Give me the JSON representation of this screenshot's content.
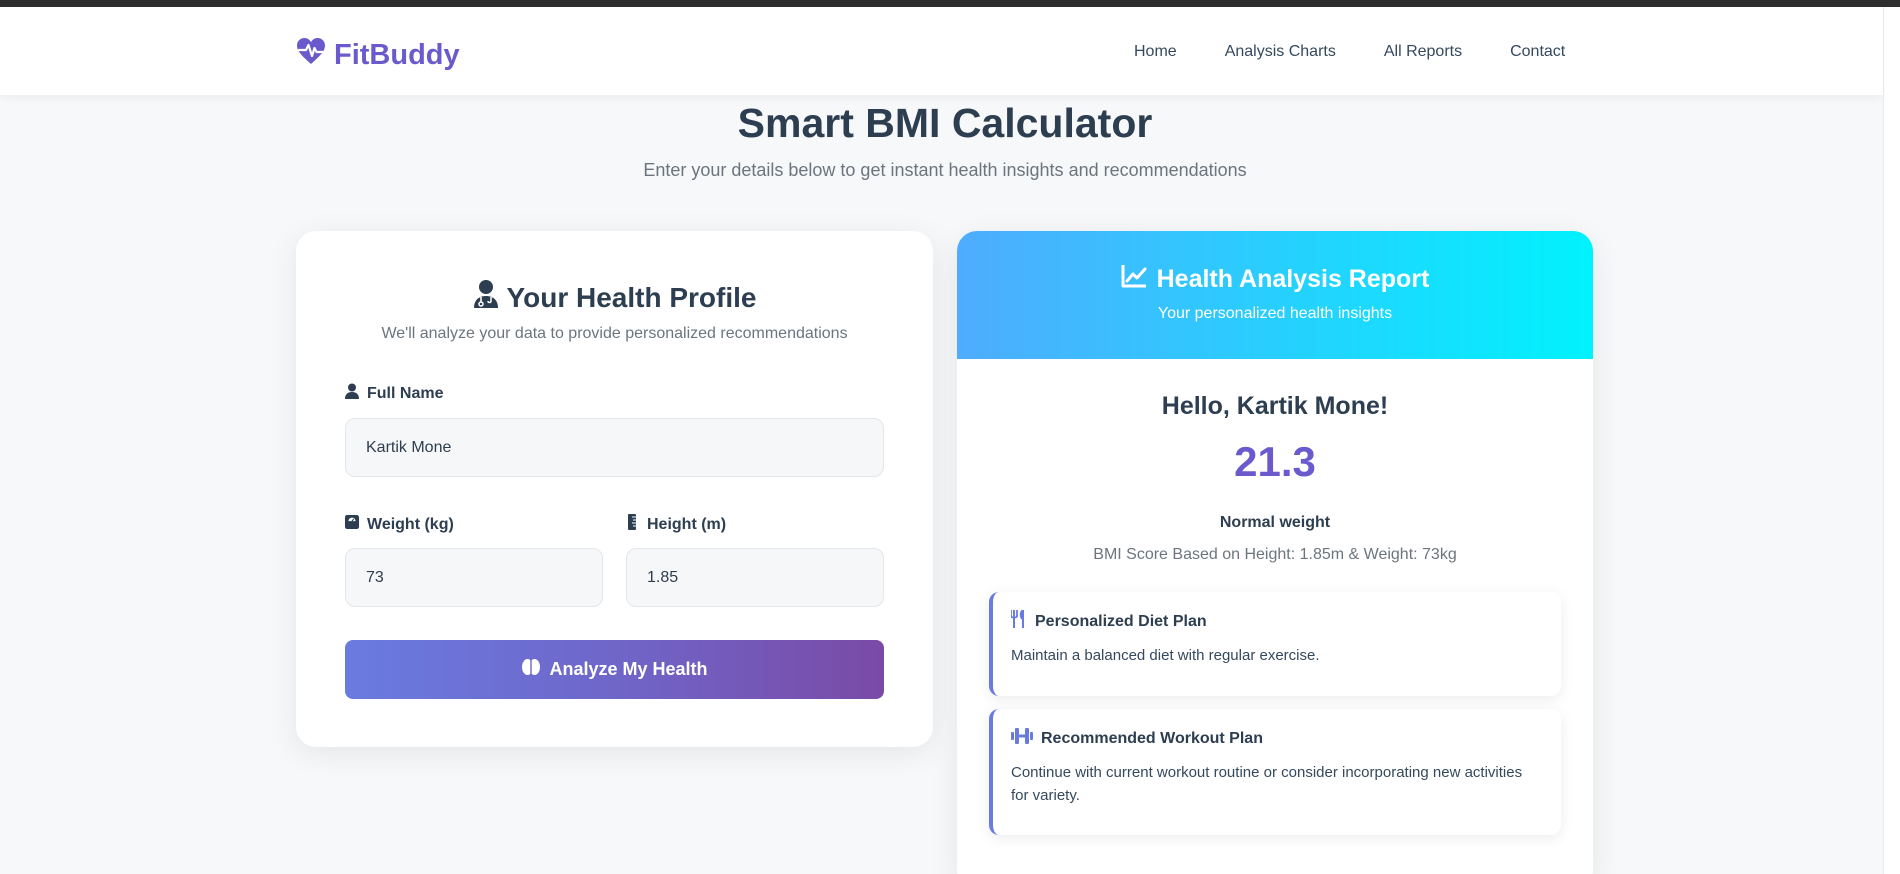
{
  "brand": {
    "name": "FitBuddy",
    "color": "#6a5acd"
  },
  "nav": [
    "Home",
    "Analysis Charts",
    "All Reports",
    "Contact"
  ],
  "hero": {
    "title": "Smart BMI Calculator",
    "subtitle": "Enter your details below to get instant health insights and recommendations"
  },
  "form": {
    "title": "Your Health Profile",
    "subtitle": "We'll analyze your data to provide personalized recommendations",
    "name_label": "Full Name",
    "name_value": "Kartik Mone",
    "weight_label": "Weight (kg)",
    "weight_value": "73",
    "height_label": "Height (m)",
    "height_value": "1.85",
    "submit_label": "Analyze My Health"
  },
  "report": {
    "title": "Health Analysis Report",
    "subtitle": "Your personalized health insights",
    "greeting": "Hello, Kartik Mone!",
    "bmi": "21.3",
    "category": "Normal weight",
    "basis": "BMI Score Based on Height: 1.85m & Weight: 73kg",
    "diet": {
      "title": "Personalized Diet Plan",
      "text": "Maintain a balanced diet with regular exercise."
    },
    "workout": {
      "title": "Recommended Workout Plan",
      "text": "Continue with current workout routine or consider incorporating new activities for variety."
    }
  },
  "icons": {
    "brand": "heart-pulse-icon",
    "profile": "user-doctor-icon",
    "name": "user-icon",
    "weight": "weight-scale-icon",
    "height": "ruler-icon",
    "analyze": "brain-icon",
    "report": "line-chart-icon",
    "diet": "utensils-icon",
    "workout": "dumbbell-icon"
  },
  "colors": {
    "accent": "#6a5acd",
    "report_gradient_start": "#4facfe",
    "report_gradient_end": "#00f2fe",
    "button_gradient_start": "#6a7be0",
    "button_gradient_end": "#7a4aa6"
  }
}
